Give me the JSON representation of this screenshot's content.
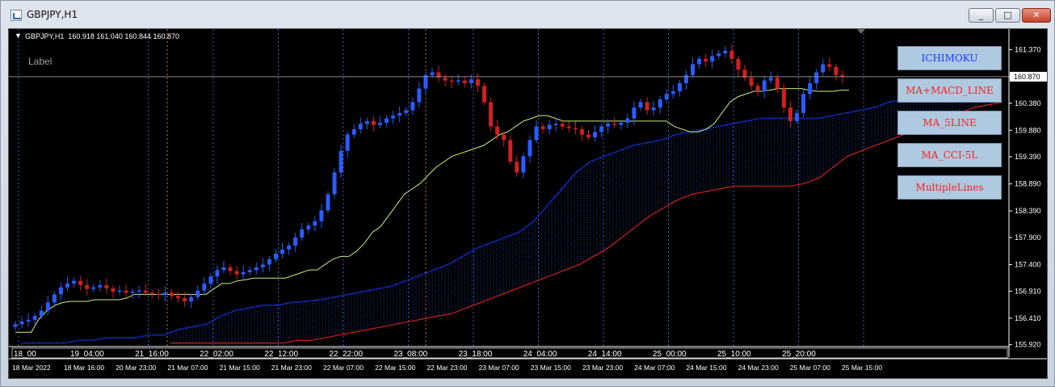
{
  "window": {
    "title": "GBPJPY,H1",
    "buttons": [
      "_",
      "□",
      "✕"
    ]
  },
  "chart_info": {
    "header": "GBPJPY,H1  160.918 161.040 160.844 160.870",
    "label_object": "Label",
    "current_price": "160.870"
  },
  "indicator_buttons": [
    {
      "label": "ICHIMOKU",
      "color": "#1a3cff"
    },
    {
      "label": "MA+MACD_LINE",
      "color": "#ff2020"
    },
    {
      "label": "MA_5LINE",
      "color": "#ff2020"
    },
    {
      "label": "MA_CCI-5L",
      "color": "#ff2020"
    },
    {
      "label": "MultipleLines",
      "color": "#ff2020"
    }
  ],
  "colors": {
    "background": "#000000",
    "bull_candle": "#2a5cff",
    "bear_candle": "#d02020",
    "tenkan": "#c8f080",
    "kumo_upper": "#1030d0",
    "kumo_lower": "#d02020",
    "grid": "#4060c0"
  },
  "chart_data": {
    "type": "candlestick",
    "symbol": "GBPJPY",
    "timeframe": "H1",
    "ylim": [
      155.9,
      161.6
    ],
    "y_ticks": [
      "161.370",
      "160.870",
      "160.380",
      "159.880",
      "159.390",
      "158.890",
      "158.390",
      "157.900",
      "157.400",
      "156.910",
      "156.410",
      "155.920"
    ],
    "x_top_ticks": [
      "18_00",
      "19_04:00",
      "21_16:00",
      "22_02:00",
      "22_12:00",
      "22_22:00",
      "23_08:00",
      "23_18:00",
      "24_04:00",
      "24_14:00",
      "25_00:00",
      "25_10:00",
      "25_20:00"
    ],
    "x_bottom_ticks": [
      "18 Mar 2022",
      "18 Mar 16:00",
      "20 Mar 23:00",
      "21 Mar 07:00",
      "21 Mar 15:00",
      "21 Mar 23:00",
      "22 Mar 07:00",
      "22 Mar 15:00",
      "22 Mar 23:00",
      "23 Mar 07:00",
      "23 Mar 15:00",
      "23 Mar 23:00",
      "24 Mar 07:00",
      "24 Mar 15:00",
      "24 Mar 23:00",
      "25 Mar 07:00",
      "25 Mar 15:00"
    ],
    "close_series": [
      156.3,
      156.35,
      156.38,
      156.45,
      156.55,
      156.7,
      156.85,
      156.98,
      157.05,
      157.1,
      157.02,
      156.95,
      156.98,
      157.02,
      156.96,
      156.9,
      156.92,
      156.88,
      156.9,
      156.92,
      156.88,
      156.86,
      156.84,
      156.88,
      156.82,
      156.78,
      156.72,
      156.8,
      156.92,
      157.05,
      157.18,
      157.3,
      157.35,
      157.28,
      157.22,
      157.26,
      157.3,
      157.35,
      157.4,
      157.5,
      157.6,
      157.68,
      157.75,
      157.9,
      158.05,
      158.12,
      158.2,
      158.4,
      158.7,
      159.1,
      159.5,
      159.8,
      159.9,
      160.0,
      160.05,
      159.98,
      160.02,
      160.1,
      160.15,
      160.2,
      160.25,
      160.4,
      160.65,
      160.9,
      160.95,
      160.85,
      160.8,
      160.78,
      160.8,
      160.75,
      160.82,
      160.7,
      160.4,
      159.95,
      159.8,
      159.7,
      159.3,
      159.1,
      159.4,
      159.7,
      159.95,
      159.9,
      159.98,
      160.0,
      159.95,
      159.92,
      159.9,
      159.8,
      159.75,
      159.85,
      159.95,
      160.0,
      159.98,
      160.02,
      160.1,
      160.3,
      160.4,
      160.25,
      160.3,
      160.45,
      160.55,
      160.6,
      160.75,
      160.9,
      161.1,
      161.2,
      161.15,
      161.25,
      161.3,
      161.35,
      161.2,
      161.0,
      160.85,
      160.7,
      160.6,
      160.8,
      160.85,
      160.65,
      160.3,
      160.05,
      160.2,
      160.55,
      160.75,
      160.95,
      161.1,
      161.05,
      160.9,
      160.87
    ],
    "tenkan_series": [
      156.15,
      156.15,
      156.15,
      156.4,
      156.55,
      156.65,
      156.7,
      156.72,
      156.72,
      156.72,
      156.75,
      156.75,
      156.75,
      156.75,
      156.78,
      156.85,
      156.85,
      156.85,
      156.85,
      156.85,
      156.85,
      156.85,
      156.85,
      156.85,
      156.85,
      156.95,
      157.05,
      157.05,
      157.1,
      157.12,
      157.15,
      157.15,
      157.15,
      157.15,
      157.15,
      157.2,
      157.25,
      157.3,
      157.3,
      157.4,
      157.5,
      157.55,
      157.55,
      157.65,
      157.8,
      158.0,
      158.1,
      158.3,
      158.5,
      158.7,
      158.8,
      158.9,
      159.05,
      159.2,
      159.3,
      159.4,
      159.45,
      159.5,
      159.55,
      159.6,
      159.7,
      159.8,
      159.85,
      159.95,
      160.05,
      160.1,
      160.15,
      160.15,
      160.1,
      160.05,
      160.05,
      160.05,
      160.05,
      160.05,
      160.05,
      160.05,
      160.05,
      160.05,
      160.05,
      160.05,
      160.05,
      160.05,
      160.05,
      159.95,
      159.9,
      159.85,
      159.85,
      159.9,
      160.0,
      160.2,
      160.4,
      160.5,
      160.55,
      160.6,
      160.6,
      160.62,
      160.65,
      160.65,
      160.65,
      160.65,
      160.62,
      160.6,
      160.6,
      160.6,
      160.62,
      160.62
    ],
    "kumo_upper_series": [
      155.95,
      155.95,
      155.95,
      155.95,
      156.0,
      156.0,
      156.05,
      156.05,
      156.05,
      156.1,
      156.1,
      156.2,
      156.25,
      156.3,
      156.45,
      156.55,
      156.6,
      156.65,
      156.65,
      156.7,
      156.72,
      156.75,
      156.8,
      156.85,
      156.9,
      156.95,
      157.0,
      157.1,
      157.2,
      157.3,
      157.4,
      157.55,
      157.7,
      157.8,
      157.9,
      158.0,
      158.2,
      158.5,
      158.8,
      159.1,
      159.3,
      159.4,
      159.5,
      159.6,
      159.65,
      159.7,
      159.8,
      159.85,
      159.9,
      159.95,
      160.0,
      160.05,
      160.1,
      160.1,
      160.1,
      160.1,
      160.1,
      160.15,
      160.2,
      160.25,
      160.3,
      160.4,
      160.45,
      160.45,
      160.45,
      160.45,
      160.5,
      160.55,
      160.6,
      160.7
    ],
    "kumo_lower_series": [
      155.95,
      155.95,
      155.95,
      155.95,
      155.95,
      155.95,
      155.95,
      155.95,
      155.95,
      156.0,
      156.0,
      156.05,
      156.1,
      156.15,
      156.2,
      156.25,
      156.3,
      156.35,
      156.4,
      156.45,
      156.5,
      156.6,
      156.7,
      156.8,
      156.9,
      157.0,
      157.1,
      157.2,
      157.3,
      157.4,
      157.55,
      157.7,
      157.9,
      158.1,
      158.3,
      158.45,
      158.6,
      158.7,
      158.75,
      158.8,
      158.85,
      158.85,
      158.85,
      158.85,
      158.85,
      158.9,
      159.0,
      159.2,
      159.4,
      159.5,
      159.6,
      159.7,
      159.8,
      159.9,
      160.0,
      160.1,
      160.2,
      160.3,
      160.35,
      160.4
    ]
  }
}
